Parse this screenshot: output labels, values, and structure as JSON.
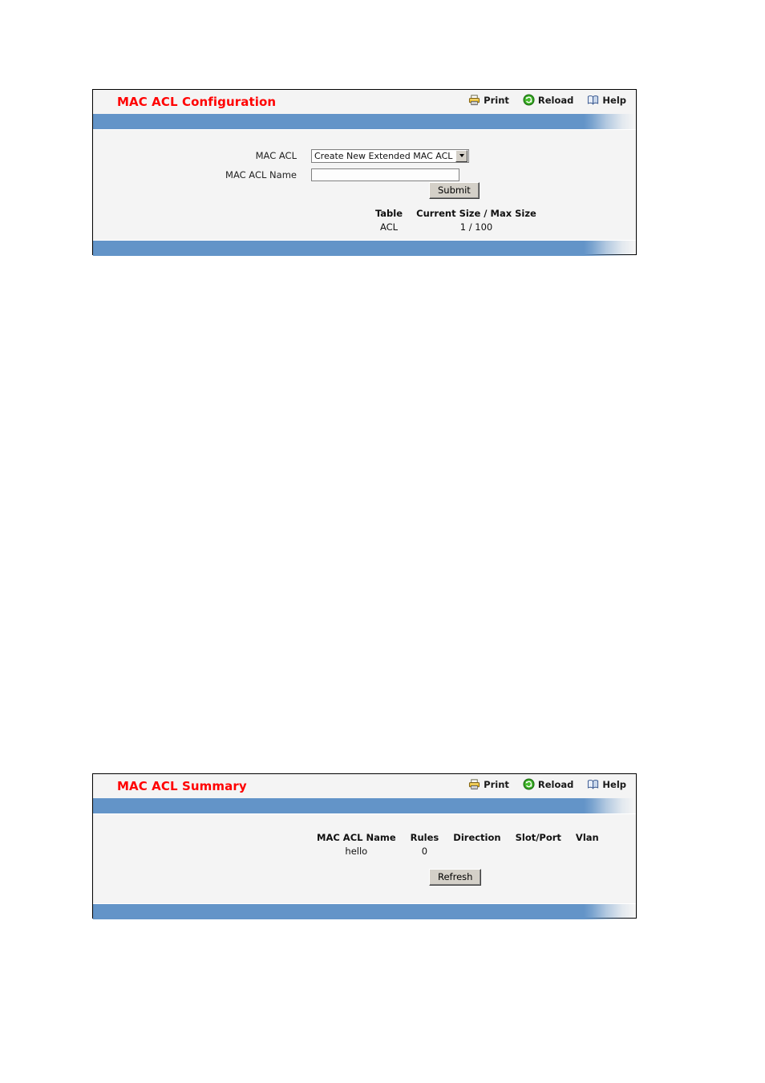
{
  "panels": [
    {
      "id": "mac-acl-configuration",
      "title": "MAC ACL Configuration",
      "toolbar": [
        {
          "label": "Print",
          "icon": "printer-icon"
        },
        {
          "label": "Reload",
          "icon": "reload-icon"
        },
        {
          "label": "Help",
          "icon": "help-book-icon"
        }
      ],
      "form": {
        "mac_acl_label": "MAC ACL",
        "mac_acl_selected": "Create New Extended MAC ACL",
        "mac_acl_options": [
          "Create New Extended MAC ACL"
        ],
        "mac_acl_name_label": "MAC ACL Name",
        "mac_acl_name_value": "",
        "mac_acl_name_placeholder": ""
      },
      "submit_label": "Submit",
      "size_table": {
        "headers": [
          "Table",
          "Current Size / Max Size"
        ],
        "rows": [
          {
            "table": "ACL",
            "size": "1 / 100"
          }
        ]
      }
    },
    {
      "id": "mac-acl-summary",
      "title": "MAC ACL Summary",
      "toolbar": [
        {
          "label": "Print",
          "icon": "printer-icon"
        },
        {
          "label": "Reload",
          "icon": "reload-icon"
        },
        {
          "label": "Help",
          "icon": "help-book-icon"
        }
      ],
      "summary_table": {
        "headers": [
          "MAC ACL Name",
          "Rules",
          "Direction",
          "Slot/Port",
          "Vlan"
        ],
        "rows": [
          {
            "name": "hello",
            "rules": "0",
            "direction": "",
            "slot_port": "",
            "vlan": ""
          }
        ]
      },
      "refresh_label": "Refresh"
    }
  ],
  "colors": {
    "title_red": "#ff0000",
    "bar_blue": "#6394c8",
    "panel_bg": "#f4f4f4",
    "button_face": "#d4d0c8"
  }
}
